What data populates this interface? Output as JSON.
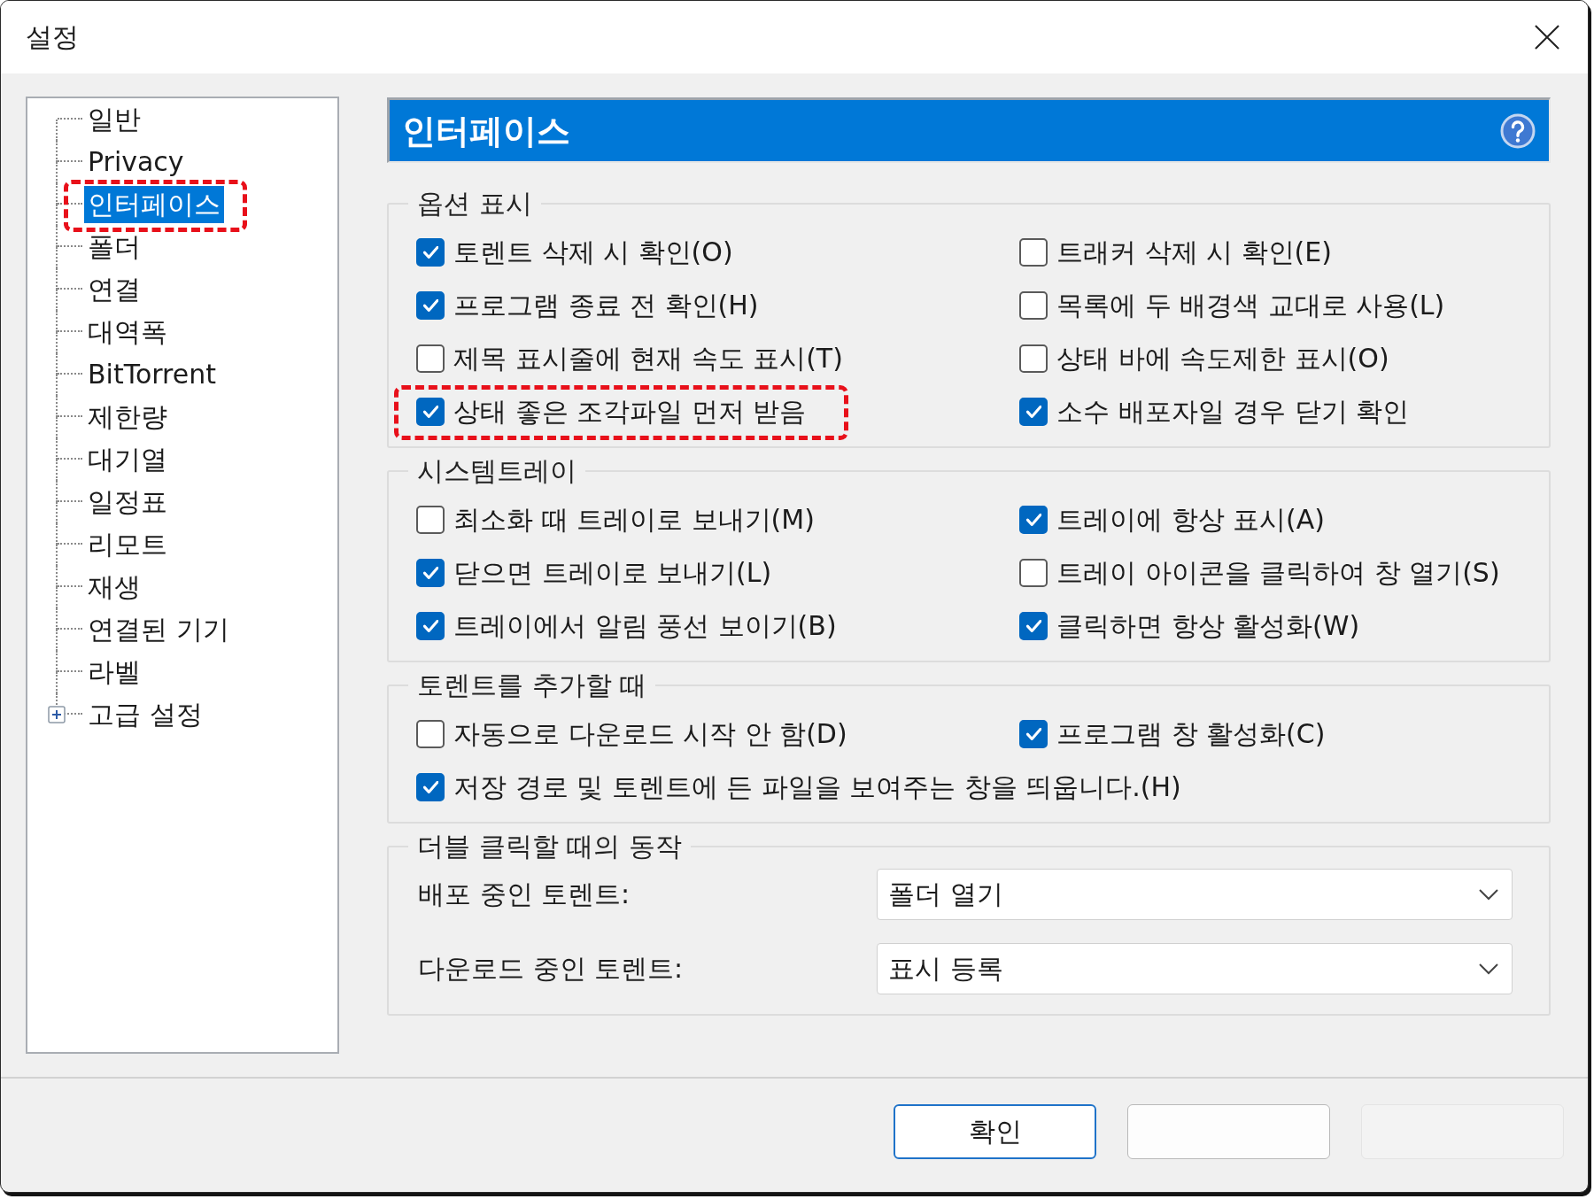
{
  "window": {
    "title": "설정"
  },
  "tree": {
    "items": [
      {
        "label": "일반",
        "kind": "leaf",
        "selected": false,
        "highlighted": false
      },
      {
        "label": "Privacy",
        "kind": "leaf",
        "selected": false,
        "highlighted": false
      },
      {
        "label": "인터페이스",
        "kind": "leaf",
        "selected": true,
        "highlighted": true
      },
      {
        "label": "폴더",
        "kind": "leaf",
        "selected": false,
        "highlighted": false
      },
      {
        "label": "연결",
        "kind": "leaf",
        "selected": false,
        "highlighted": false
      },
      {
        "label": "대역폭",
        "kind": "leaf",
        "selected": false,
        "highlighted": false
      },
      {
        "label": "BitTorrent",
        "kind": "leaf",
        "selected": false,
        "highlighted": false
      },
      {
        "label": "제한량",
        "kind": "leaf",
        "selected": false,
        "highlighted": false
      },
      {
        "label": "대기열",
        "kind": "leaf",
        "selected": false,
        "highlighted": false
      },
      {
        "label": "일정표",
        "kind": "leaf",
        "selected": false,
        "highlighted": false
      },
      {
        "label": "리모트",
        "kind": "leaf",
        "selected": false,
        "highlighted": false
      },
      {
        "label": "재생",
        "kind": "leaf",
        "selected": false,
        "highlighted": false
      },
      {
        "label": "연결된 기기",
        "kind": "leaf",
        "selected": false,
        "highlighted": false
      },
      {
        "label": "라벨",
        "kind": "leaf",
        "selected": false,
        "highlighted": false
      },
      {
        "label": "고급 설정",
        "kind": "collapsed",
        "selected": false,
        "highlighted": false
      }
    ]
  },
  "panel": {
    "title": "인터페이스",
    "groups": [
      {
        "title": "옵션 표시",
        "kind": "checkboxes",
        "options": [
          {
            "label": "토렌트 삭제 시 확인(O)",
            "checked": true,
            "highlighted": false
          },
          {
            "label": "트래커 삭제 시 확인(E)",
            "checked": false,
            "highlighted": false
          },
          {
            "label": "프로그램 종료 전 확인(H)",
            "checked": true,
            "highlighted": false
          },
          {
            "label": "목록에 두 배경색 교대로 사용(L)",
            "checked": false,
            "highlighted": false
          },
          {
            "label": "제목 표시줄에 현재 속도 표시(T)",
            "checked": false,
            "highlighted": false
          },
          {
            "label": "상태 바에 속도제한 표시(O)",
            "checked": false,
            "highlighted": false
          },
          {
            "label": "상태 좋은 조각파일 먼저 받음",
            "checked": true,
            "highlighted": true
          },
          {
            "label": "소수 배포자일 경우 닫기 확인",
            "checked": true,
            "highlighted": false
          }
        ]
      },
      {
        "title": "시스템트레이",
        "kind": "checkboxes",
        "options": [
          {
            "label": "최소화 때 트레이로 보내기(M)",
            "checked": false,
            "highlighted": false
          },
          {
            "label": "트레이에 항상 표시(A)",
            "checked": true,
            "highlighted": false
          },
          {
            "label": "닫으면 트레이로 보내기(L)",
            "checked": true,
            "highlighted": false
          },
          {
            "label": "트레이 아이콘을 클릭하여 창 열기(S)",
            "checked": false,
            "highlighted": false
          },
          {
            "label": "트레이에서 알림 풍선 보이기(B)",
            "checked": true,
            "highlighted": false
          },
          {
            "label": "클릭하면 항상 활성화(W)",
            "checked": true,
            "highlighted": false
          }
        ]
      },
      {
        "title": "토렌트를 추가할 때",
        "kind": "checkboxes",
        "options": [
          {
            "label": "자동으로 다운로드 시작 안 함(D)",
            "checked": false,
            "highlighted": false
          },
          {
            "label": "프로그램 창 활성화(C)",
            "checked": true,
            "highlighted": false
          },
          {
            "label": "저장 경로 및 토렌트에 든 파일을 보여주는 창을 띄웁니다.(H)",
            "checked": true,
            "highlighted": false
          }
        ]
      },
      {
        "title": "더블 클릭할 때의 동작",
        "kind": "dropdowns",
        "fields": [
          {
            "label": "배포 중인 토렌트:",
            "value": "폴더 열기"
          },
          {
            "label": "다운로드 중인 토렌트:",
            "value": "표시 등록"
          }
        ]
      }
    ]
  },
  "buttons": [
    {
      "label": "확인",
      "default": true,
      "disabled": false
    },
    {
      "default": false,
      "disabled": false
    },
    {
      "default": false,
      "disabled": true
    }
  ]
}
